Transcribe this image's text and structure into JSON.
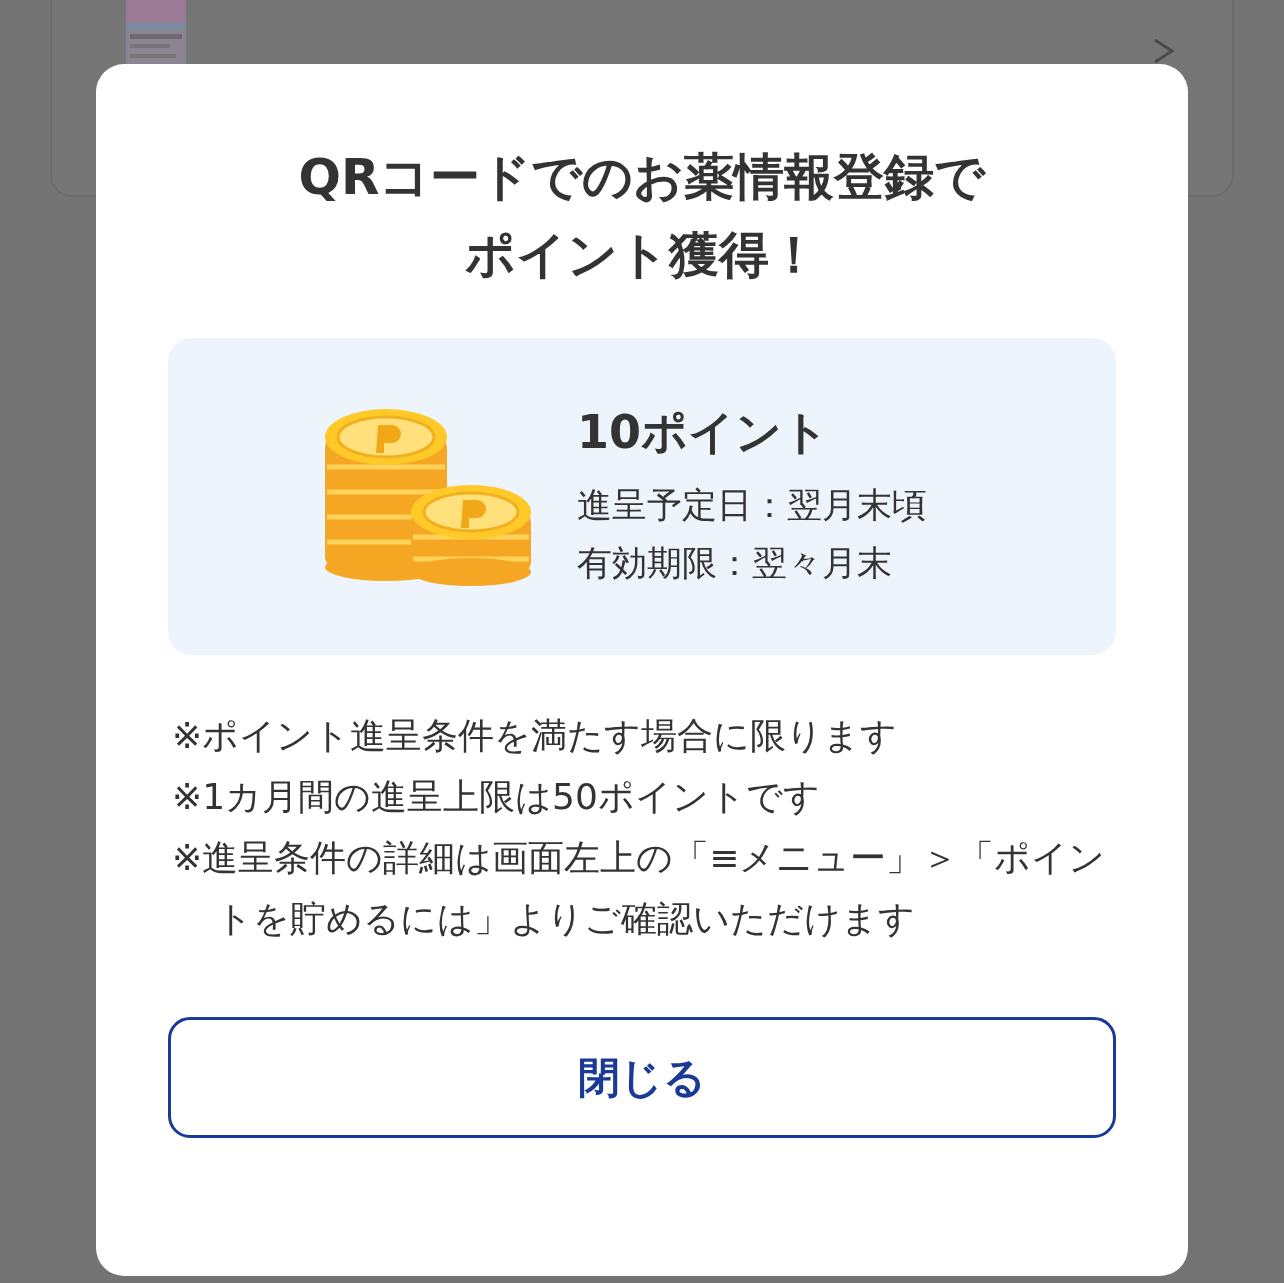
{
  "background": {
    "kind": "product-card"
  },
  "dialog": {
    "title_lines": [
      "QRコードでのお薬情報登録で",
      "ポイント獲得！"
    ],
    "reward": {
      "points": "10ポイント",
      "details": [
        "進呈予定日：翌月末頃",
        "有効期限：翌々月末"
      ]
    },
    "notes": [
      "※ポイント進呈条件を満たす場合に限ります",
      "※1カ月間の進呈上限は50ポイントです",
      "※進呈条件の詳細は画面左上の「≡メニュー」＞「ポイントを貯めるには」よりご確認いただけます"
    ],
    "close_button": "閉じる"
  }
}
